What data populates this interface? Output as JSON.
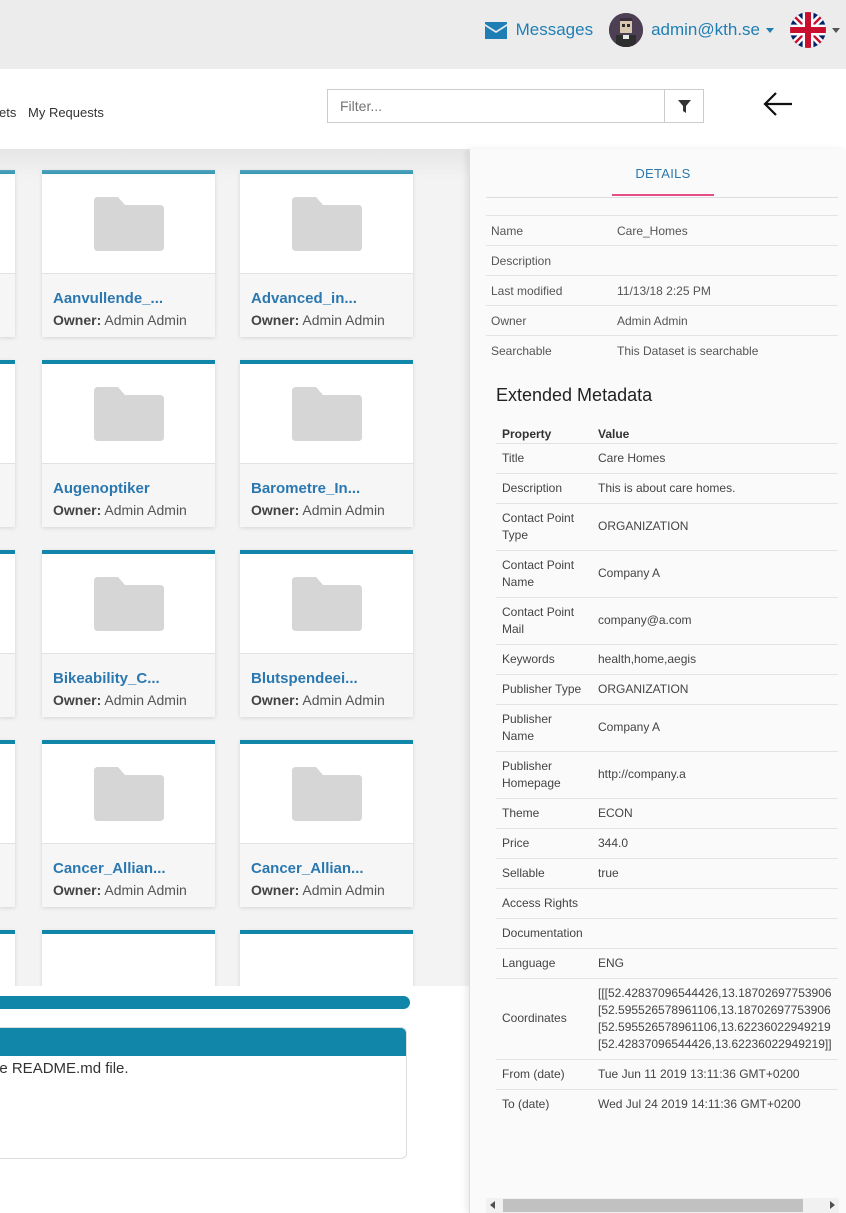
{
  "header": {
    "messages_label": "Messages",
    "user_label": "admin@kth.se",
    "icons": [
      "envelope-icon",
      "avatar",
      "uk-flag-icon",
      "chevron-down-icon"
    ],
    "accent_color": "#1f7fb5"
  },
  "nav": {
    "partial_tab_label": "ets",
    "my_requests_label": "My Requests",
    "filter_placeholder": "Filter..."
  },
  "datasets": [
    {
      "title": "Aanvullende_...",
      "owner_label": "Owner:",
      "owner": "Admin Admin"
    },
    {
      "title": "Advanced_in...",
      "owner_label": "Owner:",
      "owner": "Admin Admin"
    },
    {
      "title": "Augenoptiker",
      "owner_label": "Owner:",
      "owner": "Admin Admin"
    },
    {
      "title": "Barometre_In...",
      "owner_label": "Owner:",
      "owner": "Admin Admin"
    },
    {
      "title": "Bikeability_C...",
      "owner_label": "Owner:",
      "owner": "Admin Admin"
    },
    {
      "title": "Blutspendeei...",
      "owner_label": "Owner:",
      "owner": "Admin Admin"
    },
    {
      "title": "Cancer_Allian...",
      "owner_label": "Owner:",
      "owner": "Admin Admin"
    },
    {
      "title": "Cancer_Allian...",
      "owner_label": "Owner:",
      "owner": "Admin Admin"
    }
  ],
  "readme": {
    "text": "he README.md file."
  },
  "details": {
    "tab_label": "DETAILS",
    "info": [
      {
        "key": "Name",
        "value": "Care_Homes"
      },
      {
        "key": "Description",
        "value": ""
      },
      {
        "key": "Last modified",
        "value": "11/13/18 2:25 PM"
      },
      {
        "key": "Owner",
        "value": "Admin Admin"
      },
      {
        "key": "Searchable",
        "value": "This Dataset is searchable"
      }
    ],
    "extended_title": "Extended Metadata",
    "col_property": "Property",
    "col_value": "Value",
    "metadata": [
      {
        "key": "Title",
        "value": "Care Homes"
      },
      {
        "key": "Description",
        "value": "This is about care homes."
      },
      {
        "key": "Contact Point Type",
        "value": "ORGANIZATION"
      },
      {
        "key": "Contact Point Name",
        "value": "Company A"
      },
      {
        "key": "Contact Point Mail",
        "value": "company@a.com"
      },
      {
        "key": "Keywords",
        "value": "health,home,aegis"
      },
      {
        "key": "Publisher Type",
        "value": "ORGANIZATION"
      },
      {
        "key": "Publisher Name",
        "value": "Company A"
      },
      {
        "key": "Publisher Homepage",
        "value": "http://company.a"
      },
      {
        "key": "Theme",
        "value": "ECON"
      },
      {
        "key": "Price",
        "value": "344.0"
      },
      {
        "key": "Sellable",
        "value": "true"
      },
      {
        "key": "Access Rights",
        "value": ""
      },
      {
        "key": "Documentation",
        "value": ""
      },
      {
        "key": "Language",
        "value": "ENG"
      },
      {
        "key": "Coordinates",
        "value": "[[[52.42837096544426,13.18702697753906\n[52.595526578961106,13.18702697753906\n[52.595526578961106,13.62236022949219\n[52.42837096544426,13.62236022949219]]"
      },
      {
        "key": "From (date)",
        "value": "Tue Jun 11 2019 13:11:36 GMT+0200"
      },
      {
        "key": "To (date)",
        "value": "Wed Jul 24 2019 14:11:36 GMT+0200"
      }
    ]
  },
  "colors": {
    "card_accent": "#1186a8",
    "link": "#2b78b0",
    "tab_underline": "#e44d86"
  }
}
